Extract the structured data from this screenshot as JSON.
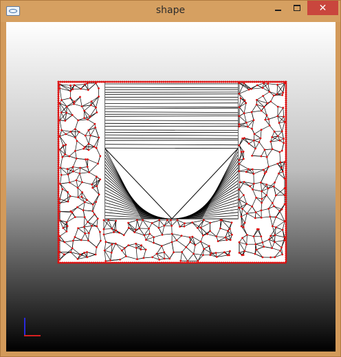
{
  "window": {
    "title": "shape",
    "close_glyph": "✕",
    "colors": {
      "frame": "#d39a5a",
      "close_button": "#c9463d",
      "mesh_fill": "#ffffff",
      "mesh_edges": "#000000",
      "mesh_vertices": "#e01010",
      "axis_x": "#d82020",
      "axis_y": "#2a2adc"
    }
  },
  "icons": {
    "app": "app-icon",
    "minimize": "minimize-icon",
    "maximize": "maximize-icon",
    "close": "close-icon",
    "axes": "axis-indicator-icon"
  }
}
